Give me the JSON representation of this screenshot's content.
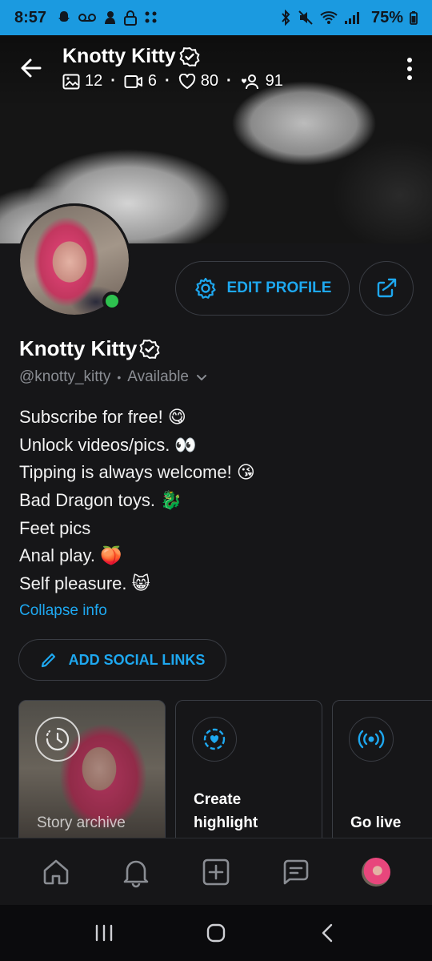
{
  "status_bar": {
    "time": "8:57",
    "battery": "75%",
    "left_icons": [
      "snapchat-icon",
      "voicemail-icon",
      "bird-icon",
      "lock-icon",
      "grid-dots-icon"
    ],
    "right_icons": [
      "bluetooth-icon",
      "mute-icon",
      "wifi-icon",
      "signal-icon",
      "battery-icon"
    ]
  },
  "header": {
    "title": "Knotty Kitty",
    "stats": {
      "photos": "12",
      "videos": "6",
      "likes": "80",
      "fans": "91"
    }
  },
  "profile": {
    "name": "Knotty Kitty",
    "handle": "@knotty_kitty",
    "availability": "Available",
    "online": true,
    "edit_profile_label": "EDIT PROFILE"
  },
  "bio": {
    "lines": [
      "Subscribe for free! 😋",
      "Unlock videos/pics. 👀",
      "Tipping is always welcome! 😘",
      "Bad Dragon toys. 🐉",
      "Feet pics",
      "Anal play. 🍑",
      "Self pleasure. 😸"
    ],
    "collapse_label": "Collapse info"
  },
  "social": {
    "add_label": "ADD SOCIAL LINKS"
  },
  "cards": {
    "archive_label": "Story archive",
    "highlight_label_1": "Create",
    "highlight_label_2": "highlight",
    "golive_label": "Go live"
  },
  "colors": {
    "accent": "#1ea8f0",
    "status_bar": "#1b9ae0",
    "background": "#161618",
    "online": "#2ec24f",
    "border": "#3a3d44"
  },
  "bottom_nav": [
    "home-icon",
    "bell-icon",
    "add-post-icon",
    "messages-icon",
    "profile-avatar"
  ],
  "system_nav": [
    "recents-icon",
    "home-circle-icon",
    "back-chevron-icon"
  ]
}
